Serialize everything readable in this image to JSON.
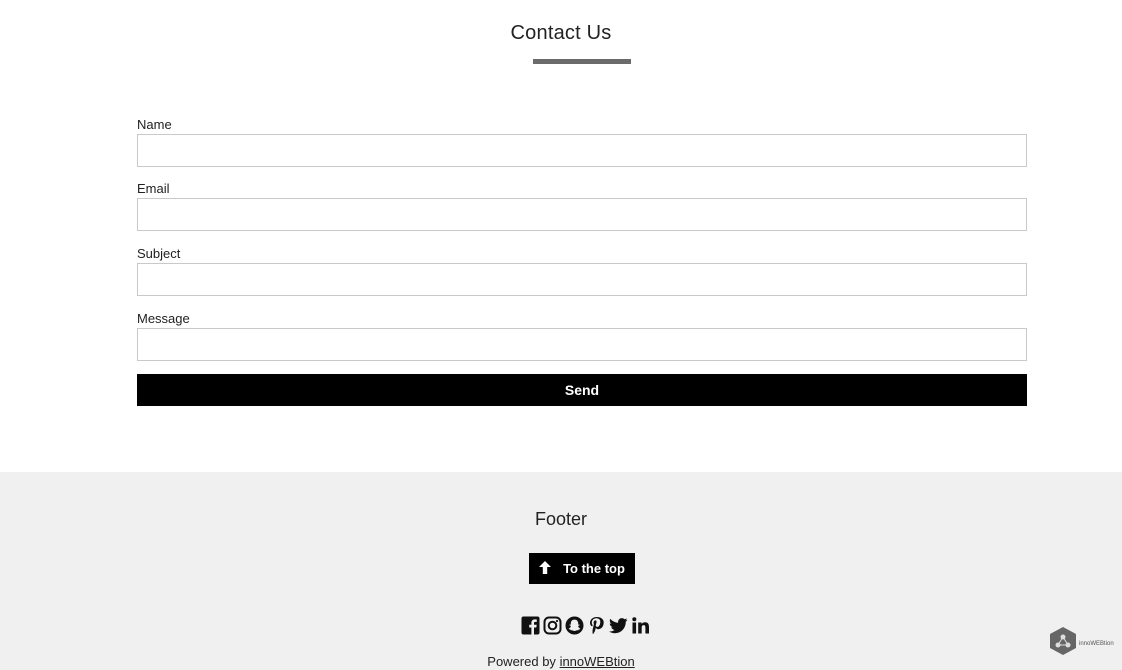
{
  "contact": {
    "title": "Contact Us",
    "fields": [
      {
        "label": "Name",
        "value": ""
      },
      {
        "label": "Email",
        "value": ""
      },
      {
        "label": "Subject",
        "value": ""
      },
      {
        "label": "Message",
        "value": ""
      }
    ],
    "send_label": "Send"
  },
  "footer": {
    "title": "Footer",
    "top_button_label": "To the top",
    "social_icons": [
      "facebook-icon",
      "instagram-icon",
      "snapchat-icon",
      "pinterest-icon",
      "twitter-icon",
      "linkedin-icon"
    ],
    "powered_prefix": "Powered by",
    "powered_link": "innoWEBtion",
    "badge_text": "innoWEBtion"
  },
  "colors": {
    "button_bg": "#000000",
    "footer_bg": "#f0f0f0",
    "underline": "#6b6b6b",
    "input_border": "#c9c9c9"
  }
}
